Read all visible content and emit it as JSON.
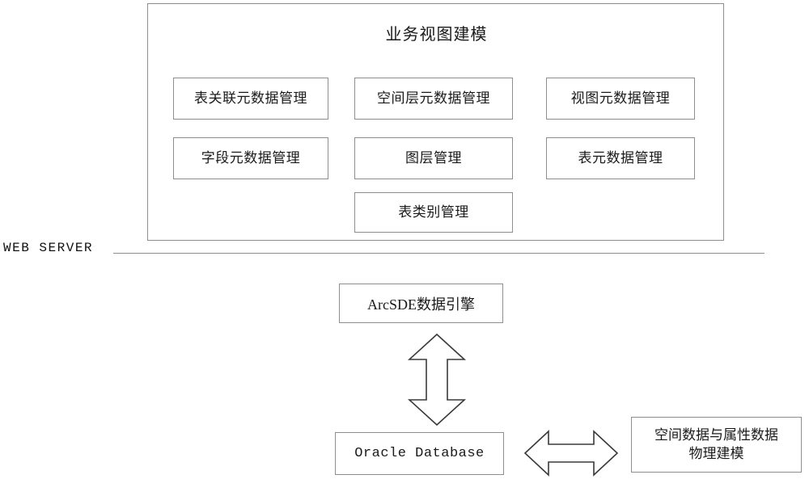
{
  "diagram": {
    "web_server": {
      "layer_label": "WEB SERVER",
      "title": "业务视图建模",
      "modules": [
        {
          "label": "表关联元数据管理",
          "column": 1,
          "row": 1
        },
        {
          "label": "空间层元数据管理",
          "column": 2,
          "row": 1
        },
        {
          "label": "视图元数据管理",
          "column": 3,
          "row": 1
        },
        {
          "label": "字段元数据管理",
          "column": 1,
          "row": 2
        },
        {
          "label": "图层管理",
          "column": 2,
          "row": 2
        },
        {
          "label": "表元数据管理",
          "column": 3,
          "row": 2
        },
        {
          "label": "表类别管理",
          "column": 2,
          "row": 3
        }
      ]
    },
    "data_layer": {
      "engine_label": "ArcSDE数据引擎",
      "database_label": "Oracle Database",
      "physical_model_line1": "空间数据与属性数据",
      "physical_model_line2": "物理建模"
    },
    "connectors": [
      {
        "name": "vertical-double-arrow",
        "orientation": "vertical",
        "from": "ArcSDE数据引擎",
        "to": "Oracle Database"
      },
      {
        "name": "horizontal-double-arrow",
        "orientation": "horizontal",
        "from": "Oracle Database",
        "to": "空间数据与属性数据物理建模"
      }
    ],
    "colors": {
      "box_border": "#8e8e8e",
      "arrow_stroke": "#3a3a3a",
      "background": "#ffffff",
      "text": "#1a1a1a"
    }
  }
}
